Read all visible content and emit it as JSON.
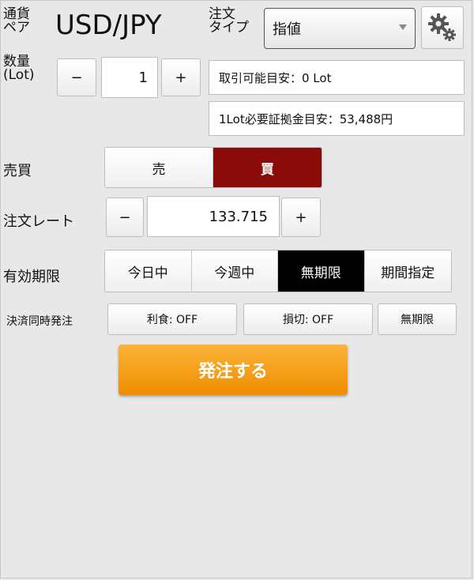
{
  "pair": {
    "label_line1": "通貨",
    "label_line2": "ペア",
    "value": "USD/JPY"
  },
  "order_type": {
    "label_line1": "注文",
    "label_line2": "タイプ",
    "selected": "指値"
  },
  "quantity": {
    "label_line1": "数量",
    "label_line2": "(Lot)",
    "minus": "−",
    "value": "1",
    "plus": "+"
  },
  "info": {
    "tradable": "取引可能目安：0 Lot",
    "margin": "1Lot必要証拠金目安：53,488円"
  },
  "side": {
    "label": "売買",
    "sell": "売",
    "buy": "買",
    "selected": "買",
    "selected_color": "#8b0a0a"
  },
  "rate": {
    "label": "注文レート",
    "minus": "−",
    "value": "133.715",
    "plus": "+"
  },
  "expiry": {
    "label": "有効期限",
    "options": [
      "今日中",
      "今週中",
      "無期限",
      "期間指定"
    ],
    "selected": "無期限"
  },
  "settlement": {
    "label": "決済同時発注",
    "take_profit": "利食: OFF",
    "stop_loss": "損切: OFF",
    "term": "無期限"
  },
  "submit": {
    "label": "発注する",
    "color": "#f59a0c"
  }
}
